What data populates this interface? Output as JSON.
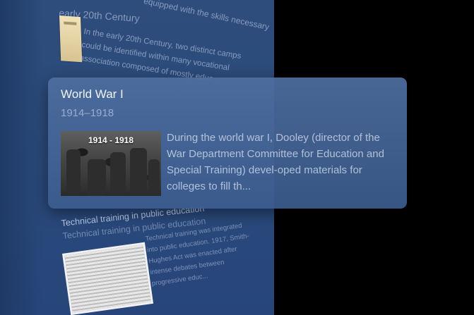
{
  "background": {
    "top_line": "equipped with the skills necessary",
    "section_title": "early 20th Century",
    "section_text": "In the early 20th Century, two distinct camps could be identified within many vocational association composed of mostly educ...",
    "tech_heading": "Technical training in public education",
    "tech_heading_ghost": "Technical training in public education",
    "tech_text": "Technical training was integrated into public education. 1917, Smith-Hughes Act was enacted after intense debates between progressive educ..."
  },
  "card": {
    "title": "World War I",
    "date_range": "1914–1918",
    "image_caption": "1914 - 1918",
    "image_icon": "photo-soldiers",
    "description": "During the world war I, Dooley (director of the War Department Committee for Education and Special Training) devel-oped materials for colleges to fill th...",
    "accent": "#4e6ea0"
  }
}
